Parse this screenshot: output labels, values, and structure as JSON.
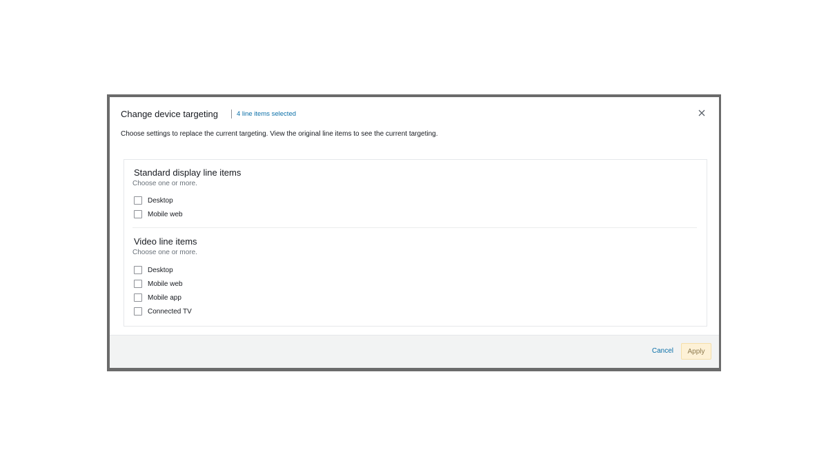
{
  "modal": {
    "title": "Change device targeting",
    "selected_link": "4 line items selected",
    "close_icon": "close-icon",
    "description": "Choose settings to replace the current targeting. View the original line items to see the current targeting."
  },
  "sections": [
    {
      "title": "Standard display line items",
      "hint": "Choose one or more.",
      "options": [
        {
          "label": "Desktop",
          "checked": false
        },
        {
          "label": "Mobile web",
          "checked": false
        }
      ]
    },
    {
      "title": "Video line items",
      "hint": "Choose one or more.",
      "options": [
        {
          "label": "Desktop",
          "checked": false
        },
        {
          "label": "Mobile web",
          "checked": false
        },
        {
          "label": "Mobile app",
          "checked": false
        },
        {
          "label": "Connected TV",
          "checked": false
        }
      ]
    }
  ],
  "footer": {
    "cancel_label": "Cancel",
    "apply_label": "Apply"
  },
  "colors": {
    "link": "#0a6fa8",
    "apply_bg": "#fdf1d6",
    "footer_bg": "#f2f3f3"
  }
}
